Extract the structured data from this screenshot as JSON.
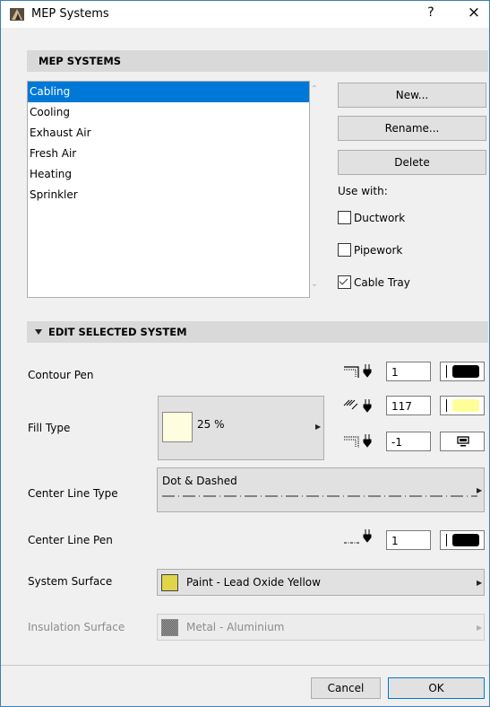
{
  "window": {
    "title": "MEP Systems",
    "help": "?",
    "close": "×"
  },
  "mep_section": {
    "title": "MEP SYSTEMS",
    "systems": [
      "Cabling",
      "Cooling",
      "Exhaust Air",
      "Fresh Air",
      "Heating",
      "Sprinkler"
    ],
    "selected": "Cabling",
    "new_label": "New...",
    "rename_label": "Rename...",
    "delete_label": "Delete",
    "use_with_label": "Use with:",
    "ductwork_label": "Ductwork",
    "pipework_label": "Pipework",
    "cabletray_label": "Cable Tray",
    "ductwork_checked": false,
    "pipework_checked": false,
    "cabletray_checked": true
  },
  "edit_section": {
    "title": "EDIT SELECTED SYSTEM",
    "contour_pen_label": "Contour Pen",
    "contour_pen_value": "1",
    "fill_type_label": "Fill Type",
    "fill_pattern_label": "25 %",
    "fill_fg_pen_value": "117",
    "fill_bg_pen_value": "-1",
    "center_line_type_label": "Center Line Type",
    "center_line_type_value": "Dot & Dashed",
    "center_line_pen_label": "Center Line Pen",
    "center_line_pen_value": "1",
    "system_surface_label": "System Surface",
    "system_surface_value": "Paint - Lead Oxide Yellow",
    "insulation_surface_label": "Insulation Surface",
    "insulation_surface_value": "Metal - Aluminium"
  },
  "footer": {
    "cancel_label": "Cancel",
    "ok_label": "OK"
  },
  "colors": {
    "selection": "#0078d7",
    "contour_pen_color": "#000000",
    "fill_fg_color": "#ffff99",
    "fill_bg_color": "#ffffff",
    "center_line_pen_color": "#000000",
    "system_surface_color": "#e0d44a",
    "fill_swatch_color": "#fffde0"
  }
}
